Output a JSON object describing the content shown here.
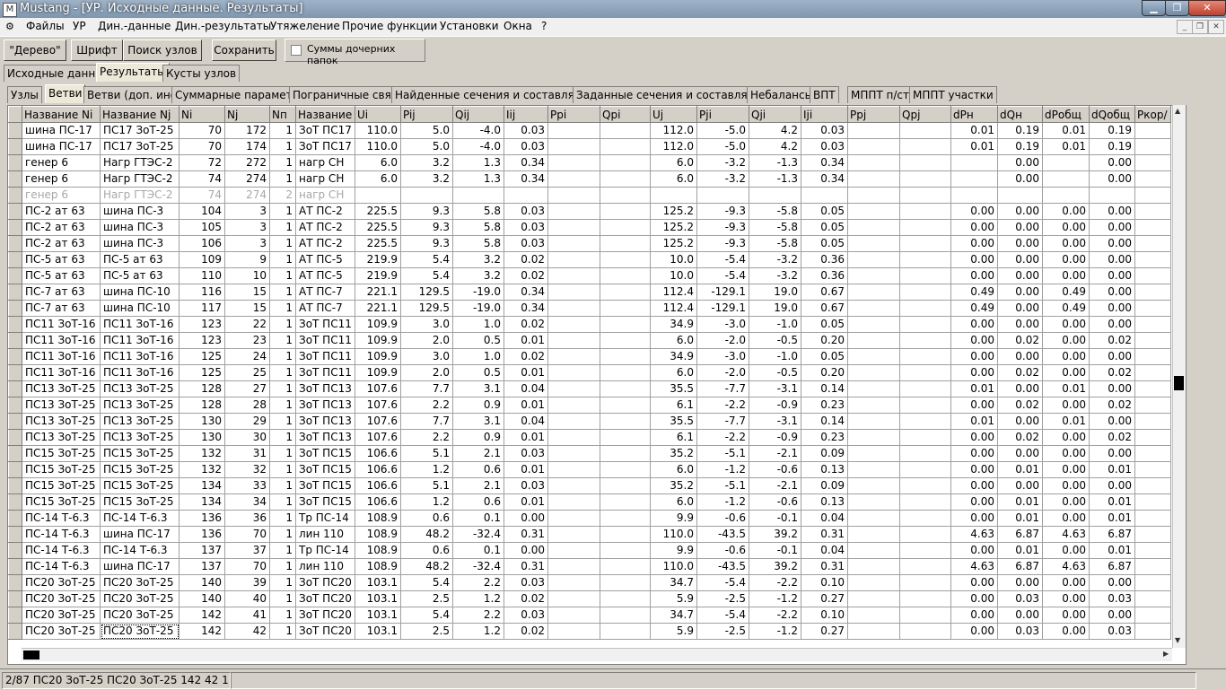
{
  "window": {
    "title": "Mustang - [УР. Исходные данные. Результаты]"
  },
  "menu": [
    "Файлы",
    "УР",
    "Дин.-данные",
    "Дин.-результаты",
    "Утяжеление",
    "Прочие функции",
    "Установки",
    "Окна",
    "?"
  ],
  "toolbar": {
    "tree_label": "\"Дерево\"",
    "font_label": "Шрифт",
    "search_label": "Поиск узлов",
    "save_label": "Сохранить",
    "sums_label": "Суммы дочерних папок"
  },
  "top_tabs": [
    "Исходные данные",
    "Результаты",
    "Кусты узлов"
  ],
  "sub_tabs": [
    "Узлы",
    "Ветви",
    "Ветви (доп. инф.)",
    "Суммарные параметры",
    "Пограничные связи",
    "Найденные сечения и составляющие",
    "Заданные сечения и составляющие",
    "Небалансы",
    "ВПТ",
    "МППТ п/ст",
    "МППТ участки"
  ],
  "columns": [
    "Название Ni",
    "Название Nj",
    "Ni",
    "Nj",
    "Nп",
    "Название",
    "Ui",
    "Pij",
    "Qij",
    "Iij",
    "Ppi",
    "Qpi",
    "Uj",
    "Pji",
    "Qji",
    "Iji",
    "Ppj",
    "Qpj",
    "dPн",
    "dQн",
    "dPобщ",
    "dQобщ",
    "Pкор/"
  ],
  "rows": [
    [
      "шина ПС-17",
      "ПС17 ЗоТ-25",
      "70",
      "172",
      "1",
      "ЗоТ ПС17",
      "110.0",
      "5.0",
      "-4.0",
      "0.03",
      "",
      "",
      "112.0",
      "-5.0",
      "4.2",
      "0.03",
      "",
      "",
      "0.01",
      "0.19",
      "0.01",
      "0.19",
      ""
    ],
    [
      "шина ПС-17",
      "ПС17 ЗоТ-25",
      "70",
      "174",
      "1",
      "ЗоТ ПС17",
      "110.0",
      "5.0",
      "-4.0",
      "0.03",
      "",
      "",
      "112.0",
      "-5.0",
      "4.2",
      "0.03",
      "",
      "",
      "0.01",
      "0.19",
      "0.01",
      "0.19",
      ""
    ],
    [
      "генер 6",
      "Нагр ГТЭС-2",
      "72",
      "272",
      "1",
      "нагр СН",
      "6.0",
      "3.2",
      "1.3",
      "0.34",
      "",
      "",
      "6.0",
      "-3.2",
      "-1.3",
      "0.34",
      "",
      "",
      "",
      "0.00",
      "",
      "0.00",
      ""
    ],
    [
      "генер 6",
      "Нагр ГТЭС-2",
      "74",
      "274",
      "1",
      "нагр СН",
      "6.0",
      "3.2",
      "1.3",
      "0.34",
      "",
      "",
      "6.0",
      "-3.2",
      "-1.3",
      "0.34",
      "",
      "",
      "",
      "0.00",
      "",
      "0.00",
      ""
    ],
    [
      "генер 6",
      "Нагр ГТЭС-2",
      "74",
      "274",
      "2",
      "нагр СН",
      "",
      "",
      "",
      "",
      "",
      "",
      "",
      "",
      "",
      "",
      "",
      "",
      "",
      "",
      "",
      "",
      ""
    ],
    [
      "ПС-2 ат 63",
      "шина ПС-3",
      "104",
      "3",
      "1",
      "АТ ПС-2",
      "225.5",
      "9.3",
      "5.8",
      "0.03",
      "",
      "",
      "125.2",
      "-9.3",
      "-5.8",
      "0.05",
      "",
      "",
      "0.00",
      "0.00",
      "0.00",
      "0.00",
      ""
    ],
    [
      "ПС-2 ат 63",
      "шина ПС-3",
      "105",
      "3",
      "1",
      "АТ ПС-2",
      "225.5",
      "9.3",
      "5.8",
      "0.03",
      "",
      "",
      "125.2",
      "-9.3",
      "-5.8",
      "0.05",
      "",
      "",
      "0.00",
      "0.00",
      "0.00",
      "0.00",
      ""
    ],
    [
      "ПС-2 ат 63",
      "шина ПС-3",
      "106",
      "3",
      "1",
      "АТ ПС-2",
      "225.5",
      "9.3",
      "5.8",
      "0.03",
      "",
      "",
      "125.2",
      "-9.3",
      "-5.8",
      "0.05",
      "",
      "",
      "0.00",
      "0.00",
      "0.00",
      "0.00",
      ""
    ],
    [
      "ПС-5 ат 63",
      "ПС-5 ат 63",
      "109",
      "9",
      "1",
      "АТ ПС-5",
      "219.9",
      "5.4",
      "3.2",
      "0.02",
      "",
      "",
      "10.0",
      "-5.4",
      "-3.2",
      "0.36",
      "",
      "",
      "0.00",
      "0.00",
      "0.00",
      "0.00",
      ""
    ],
    [
      "ПС-5 ат 63",
      "ПС-5 ат 63",
      "110",
      "10",
      "1",
      "АТ ПС-5",
      "219.9",
      "5.4",
      "3.2",
      "0.02",
      "",
      "",
      "10.0",
      "-5.4",
      "-3.2",
      "0.36",
      "",
      "",
      "0.00",
      "0.00",
      "0.00",
      "0.00",
      ""
    ],
    [
      "ПС-7 ат 63",
      "шина ПС-10",
      "116",
      "15",
      "1",
      "АТ ПС-7",
      "221.1",
      "129.5",
      "-19.0",
      "0.34",
      "",
      "",
      "112.4",
      "-129.1",
      "19.0",
      "0.67",
      "",
      "",
      "0.49",
      "0.00",
      "0.49",
      "0.00",
      ""
    ],
    [
      "ПС-7 ат 63",
      "шина ПС-10",
      "117",
      "15",
      "1",
      "АТ ПС-7",
      "221.1",
      "129.5",
      "-19.0",
      "0.34",
      "",
      "",
      "112.4",
      "-129.1",
      "19.0",
      "0.67",
      "",
      "",
      "0.49",
      "0.00",
      "0.49",
      "0.00",
      ""
    ],
    [
      "ПС11 ЗоТ-16",
      "ПС11 ЗоТ-16",
      "123",
      "22",
      "1",
      "ЗоТ ПС11",
      "109.9",
      "3.0",
      "1.0",
      "0.02",
      "",
      "",
      "34.9",
      "-3.0",
      "-1.0",
      "0.05",
      "",
      "",
      "0.00",
      "0.00",
      "0.00",
      "0.00",
      ""
    ],
    [
      "ПС11 ЗоТ-16",
      "ПС11 ЗоТ-16",
      "123",
      "23",
      "1",
      "ЗоТ ПС11",
      "109.9",
      "2.0",
      "0.5",
      "0.01",
      "",
      "",
      "6.0",
      "-2.0",
      "-0.5",
      "0.20",
      "",
      "",
      "0.00",
      "0.02",
      "0.00",
      "0.02",
      ""
    ],
    [
      "ПС11 ЗоТ-16",
      "ПС11 ЗоТ-16",
      "125",
      "24",
      "1",
      "ЗоТ ПС11",
      "109.9",
      "3.0",
      "1.0",
      "0.02",
      "",
      "",
      "34.9",
      "-3.0",
      "-1.0",
      "0.05",
      "",
      "",
      "0.00",
      "0.00",
      "0.00",
      "0.00",
      ""
    ],
    [
      "ПС11 ЗоТ-16",
      "ПС11 ЗоТ-16",
      "125",
      "25",
      "1",
      "ЗоТ ПС11",
      "109.9",
      "2.0",
      "0.5",
      "0.01",
      "",
      "",
      "6.0",
      "-2.0",
      "-0.5",
      "0.20",
      "",
      "",
      "0.00",
      "0.02",
      "0.00",
      "0.02",
      ""
    ],
    [
      "ПС13 ЗоТ-25",
      "ПС13 ЗоТ-25",
      "128",
      "27",
      "1",
      "ЗоТ ПС13",
      "107.6",
      "7.7",
      "3.1",
      "0.04",
      "",
      "",
      "35.5",
      "-7.7",
      "-3.1",
      "0.14",
      "",
      "",
      "0.01",
      "0.00",
      "0.01",
      "0.00",
      ""
    ],
    [
      "ПС13 ЗоТ-25",
      "ПС13 ЗоТ-25",
      "128",
      "28",
      "1",
      "ЗоТ ПС13",
      "107.6",
      "2.2",
      "0.9",
      "0.01",
      "",
      "",
      "6.1",
      "-2.2",
      "-0.9",
      "0.23",
      "",
      "",
      "0.00",
      "0.02",
      "0.00",
      "0.02",
      ""
    ],
    [
      "ПС13 ЗоТ-25",
      "ПС13 ЗоТ-25",
      "130",
      "29",
      "1",
      "ЗоТ ПС13",
      "107.6",
      "7.7",
      "3.1",
      "0.04",
      "",
      "",
      "35.5",
      "-7.7",
      "-3.1",
      "0.14",
      "",
      "",
      "0.01",
      "0.00",
      "0.01",
      "0.00",
      ""
    ],
    [
      "ПС13 ЗоТ-25",
      "ПС13 ЗоТ-25",
      "130",
      "30",
      "1",
      "ЗоТ ПС13",
      "107.6",
      "2.2",
      "0.9",
      "0.01",
      "",
      "",
      "6.1",
      "-2.2",
      "-0.9",
      "0.23",
      "",
      "",
      "0.00",
      "0.02",
      "0.00",
      "0.02",
      ""
    ],
    [
      "ПС15 ЗоТ-25",
      "ПС15 ЗоТ-25",
      "132",
      "31",
      "1",
      "ЗоТ ПС15",
      "106.6",
      "5.1",
      "2.1",
      "0.03",
      "",
      "",
      "35.2",
      "-5.1",
      "-2.1",
      "0.09",
      "",
      "",
      "0.00",
      "0.00",
      "0.00",
      "0.00",
      ""
    ],
    [
      "ПС15 ЗоТ-25",
      "ПС15 ЗоТ-25",
      "132",
      "32",
      "1",
      "ЗоТ ПС15",
      "106.6",
      "1.2",
      "0.6",
      "0.01",
      "",
      "",
      "6.0",
      "-1.2",
      "-0.6",
      "0.13",
      "",
      "",
      "0.00",
      "0.01",
      "0.00",
      "0.01",
      ""
    ],
    [
      "ПС15 ЗоТ-25",
      "ПС15 ЗоТ-25",
      "134",
      "33",
      "1",
      "ЗоТ ПС15",
      "106.6",
      "5.1",
      "2.1",
      "0.03",
      "",
      "",
      "35.2",
      "-5.1",
      "-2.1",
      "0.09",
      "",
      "",
      "0.00",
      "0.00",
      "0.00",
      "0.00",
      ""
    ],
    [
      "ПС15 ЗоТ-25",
      "ПС15 ЗоТ-25",
      "134",
      "34",
      "1",
      "ЗоТ ПС15",
      "106.6",
      "1.2",
      "0.6",
      "0.01",
      "",
      "",
      "6.0",
      "-1.2",
      "-0.6",
      "0.13",
      "",
      "",
      "0.00",
      "0.01",
      "0.00",
      "0.01",
      ""
    ],
    [
      "ПС-14 Т-6.3",
      "ПС-14 Т-6.3",
      "136",
      "36",
      "1",
      "Тр ПС-14",
      "108.9",
      "0.6",
      "0.1",
      "0.00",
      "",
      "",
      "9.9",
      "-0.6",
      "-0.1",
      "0.04",
      "",
      "",
      "0.00",
      "0.01",
      "0.00",
      "0.01",
      ""
    ],
    [
      "ПС-14 Т-6.3",
      "шина ПС-17",
      "136",
      "70",
      "1",
      "лин 110",
      "108.9",
      "48.2",
      "-32.4",
      "0.31",
      "",
      "",
      "110.0",
      "-43.5",
      "39.2",
      "0.31",
      "",
      "",
      "4.63",
      "6.87",
      "4.63",
      "6.87",
      ""
    ],
    [
      "ПС-14 Т-6.3",
      "ПС-14 Т-6.3",
      "137",
      "37",
      "1",
      "Тр ПС-14",
      "108.9",
      "0.6",
      "0.1",
      "0.00",
      "",
      "",
      "9.9",
      "-0.6",
      "-0.1",
      "0.04",
      "",
      "",
      "0.00",
      "0.01",
      "0.00",
      "0.01",
      ""
    ],
    [
      "ПС-14 Т-6.3",
      "шина ПС-17",
      "137",
      "70",
      "1",
      "лин 110",
      "108.9",
      "48.2",
      "-32.4",
      "0.31",
      "",
      "",
      "110.0",
      "-43.5",
      "39.2",
      "0.31",
      "",
      "",
      "4.63",
      "6.87",
      "4.63",
      "6.87",
      ""
    ],
    [
      "ПС20 ЗоТ-25",
      "ПС20 ЗоТ-25",
      "140",
      "39",
      "1",
      "ЗоТ ПС20",
      "103.1",
      "5.4",
      "2.2",
      "0.03",
      "",
      "",
      "34.7",
      "-5.4",
      "-2.2",
      "0.10",
      "",
      "",
      "0.00",
      "0.00",
      "0.00",
      "0.00",
      ""
    ],
    [
      "ПС20 ЗоТ-25",
      "ПС20 ЗоТ-25",
      "140",
      "40",
      "1",
      "ЗоТ ПС20",
      "103.1",
      "2.5",
      "1.2",
      "0.02",
      "",
      "",
      "5.9",
      "-2.5",
      "-1.2",
      "0.27",
      "",
      "",
      "0.00",
      "0.03",
      "0.00",
      "0.03",
      ""
    ],
    [
      "ПС20 ЗоТ-25",
      "ПС20 ЗоТ-25",
      "142",
      "41",
      "1",
      "ЗоТ ПС20",
      "103.1",
      "5.4",
      "2.2",
      "0.03",
      "",
      "",
      "34.7",
      "-5.4",
      "-2.2",
      "0.10",
      "",
      "",
      "0.00",
      "0.00",
      "0.00",
      "0.00",
      ""
    ],
    [
      "ПС20 ЗоТ-25",
      "ПС20 ЗоТ-25",
      "142",
      "42",
      "1",
      "ЗоТ ПС20",
      "103.1",
      "2.5",
      "1.2",
      "0.02",
      "",
      "",
      "5.9",
      "-2.5",
      "-1.2",
      "0.27",
      "",
      "",
      "0.00",
      "0.03",
      "0.00",
      "0.03",
      ""
    ]
  ],
  "status": {
    "position": "2/87 ПС20 ЗоТ-25  ПС20 ЗоТ-25  142 42 1"
  }
}
